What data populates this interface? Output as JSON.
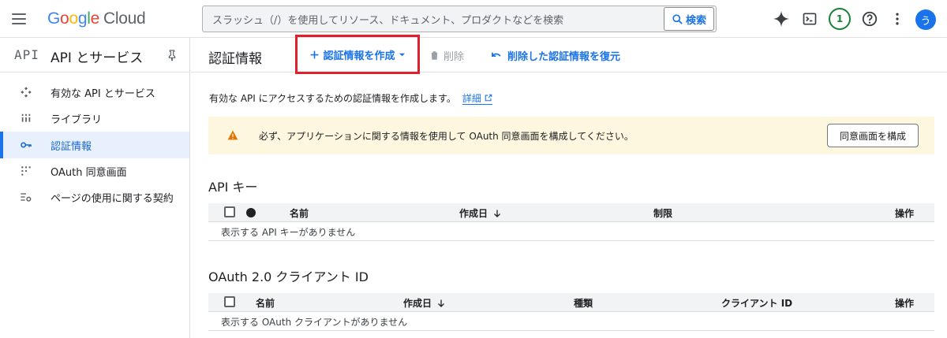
{
  "topbar": {
    "logo_letters": [
      "G",
      "o",
      "o",
      "g",
      "l",
      "e"
    ],
    "logo_cloud": "Cloud",
    "search_placeholder": "スラッシュ（/）を使用してリソース、ドキュメント、プロダクトなどを検索",
    "search_button": "検索",
    "notification_count": "1",
    "avatar_letter": "う"
  },
  "sidebar": {
    "logo": "API",
    "title": "API とサービス",
    "items": [
      {
        "label": "有効な API とサービス",
        "icon": "api-services-icon",
        "active": false
      },
      {
        "label": "ライブラリ",
        "icon": "library-icon",
        "active": false
      },
      {
        "label": "認証情報",
        "icon": "key-icon",
        "active": true
      },
      {
        "label": "OAuth 同意画面",
        "icon": "consent-icon",
        "active": false
      },
      {
        "label": "ページの使用に関する契約",
        "icon": "terms-settings-icon",
        "active": false
      }
    ]
  },
  "main": {
    "title": "認証情報",
    "create_label": "認証情報を作成",
    "delete_label": "削除",
    "restore_label": "削除した認証情報を復元",
    "description": "有効な API にアクセスするための認証情報を作成します。",
    "details_link": "詳細",
    "banner_text": "必ず、アプリケーションに関する情報を使用して OAuth 同意画面を構成してください。",
    "banner_button": "同意画面を構成",
    "api_keys": {
      "title": "API キー",
      "columns": [
        "名前",
        "作成日",
        "制限",
        "操作"
      ],
      "empty": "表示する API キーがありません"
    },
    "oauth": {
      "title": "OAuth 2.0 クライアント ID",
      "columns": [
        "名前",
        "作成日",
        "種類",
        "クライアント ID",
        "操作"
      ],
      "empty": "表示する OAuth クライアントがありません"
    }
  },
  "colors": {
    "accent": "#1a73e8",
    "highlight_border": "#e0202c",
    "banner_bg": "#fef7e0",
    "warning": "#e37400"
  }
}
